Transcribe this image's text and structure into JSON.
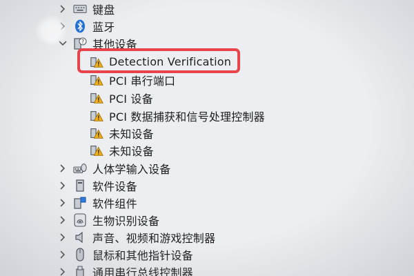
{
  "device_tree": {
    "categories": [
      {
        "label": "键盘",
        "icon": "keyboard-icon",
        "expanded": false
      },
      {
        "label": "蓝牙",
        "icon": "bluetooth-icon",
        "expanded": false
      },
      {
        "label": "其他设备",
        "icon": "unknown-device-icon",
        "expanded": true,
        "children": [
          {
            "label": "Detection Verification",
            "icon": "warning-device-icon",
            "highlighted": true
          },
          {
            "label": "PCI 串行端口",
            "icon": "warning-device-icon"
          },
          {
            "label": "PCI 设备",
            "icon": "warning-device-icon"
          },
          {
            "label": "PCI 数据捕获和信号处理控制器",
            "icon": "warning-device-icon"
          },
          {
            "label": "未知设备",
            "icon": "warning-device-icon"
          },
          {
            "label": "未知设备",
            "icon": "warning-device-icon"
          }
        ]
      },
      {
        "label": "人体学输入设备",
        "icon": "hid-icon",
        "expanded": false
      },
      {
        "label": "软件设备",
        "icon": "software-device-icon",
        "expanded": false
      },
      {
        "label": "软件组件",
        "icon": "software-component-icon",
        "expanded": false
      },
      {
        "label": "生物识别设备",
        "icon": "fingerprint-icon",
        "expanded": false
      },
      {
        "label": "声音、视频和游戏控制器",
        "icon": "speaker-icon",
        "expanded": false
      },
      {
        "label": "鼠标和其他指针设备",
        "icon": "mouse-icon",
        "expanded": false
      },
      {
        "label": "通用串行总线控制器",
        "icon": "usb-icon",
        "expanded": false
      }
    ]
  },
  "colors": {
    "highlight_border": "#e8424b",
    "warning": "#f2b01e",
    "bluetooth": "#1e6fd9"
  }
}
